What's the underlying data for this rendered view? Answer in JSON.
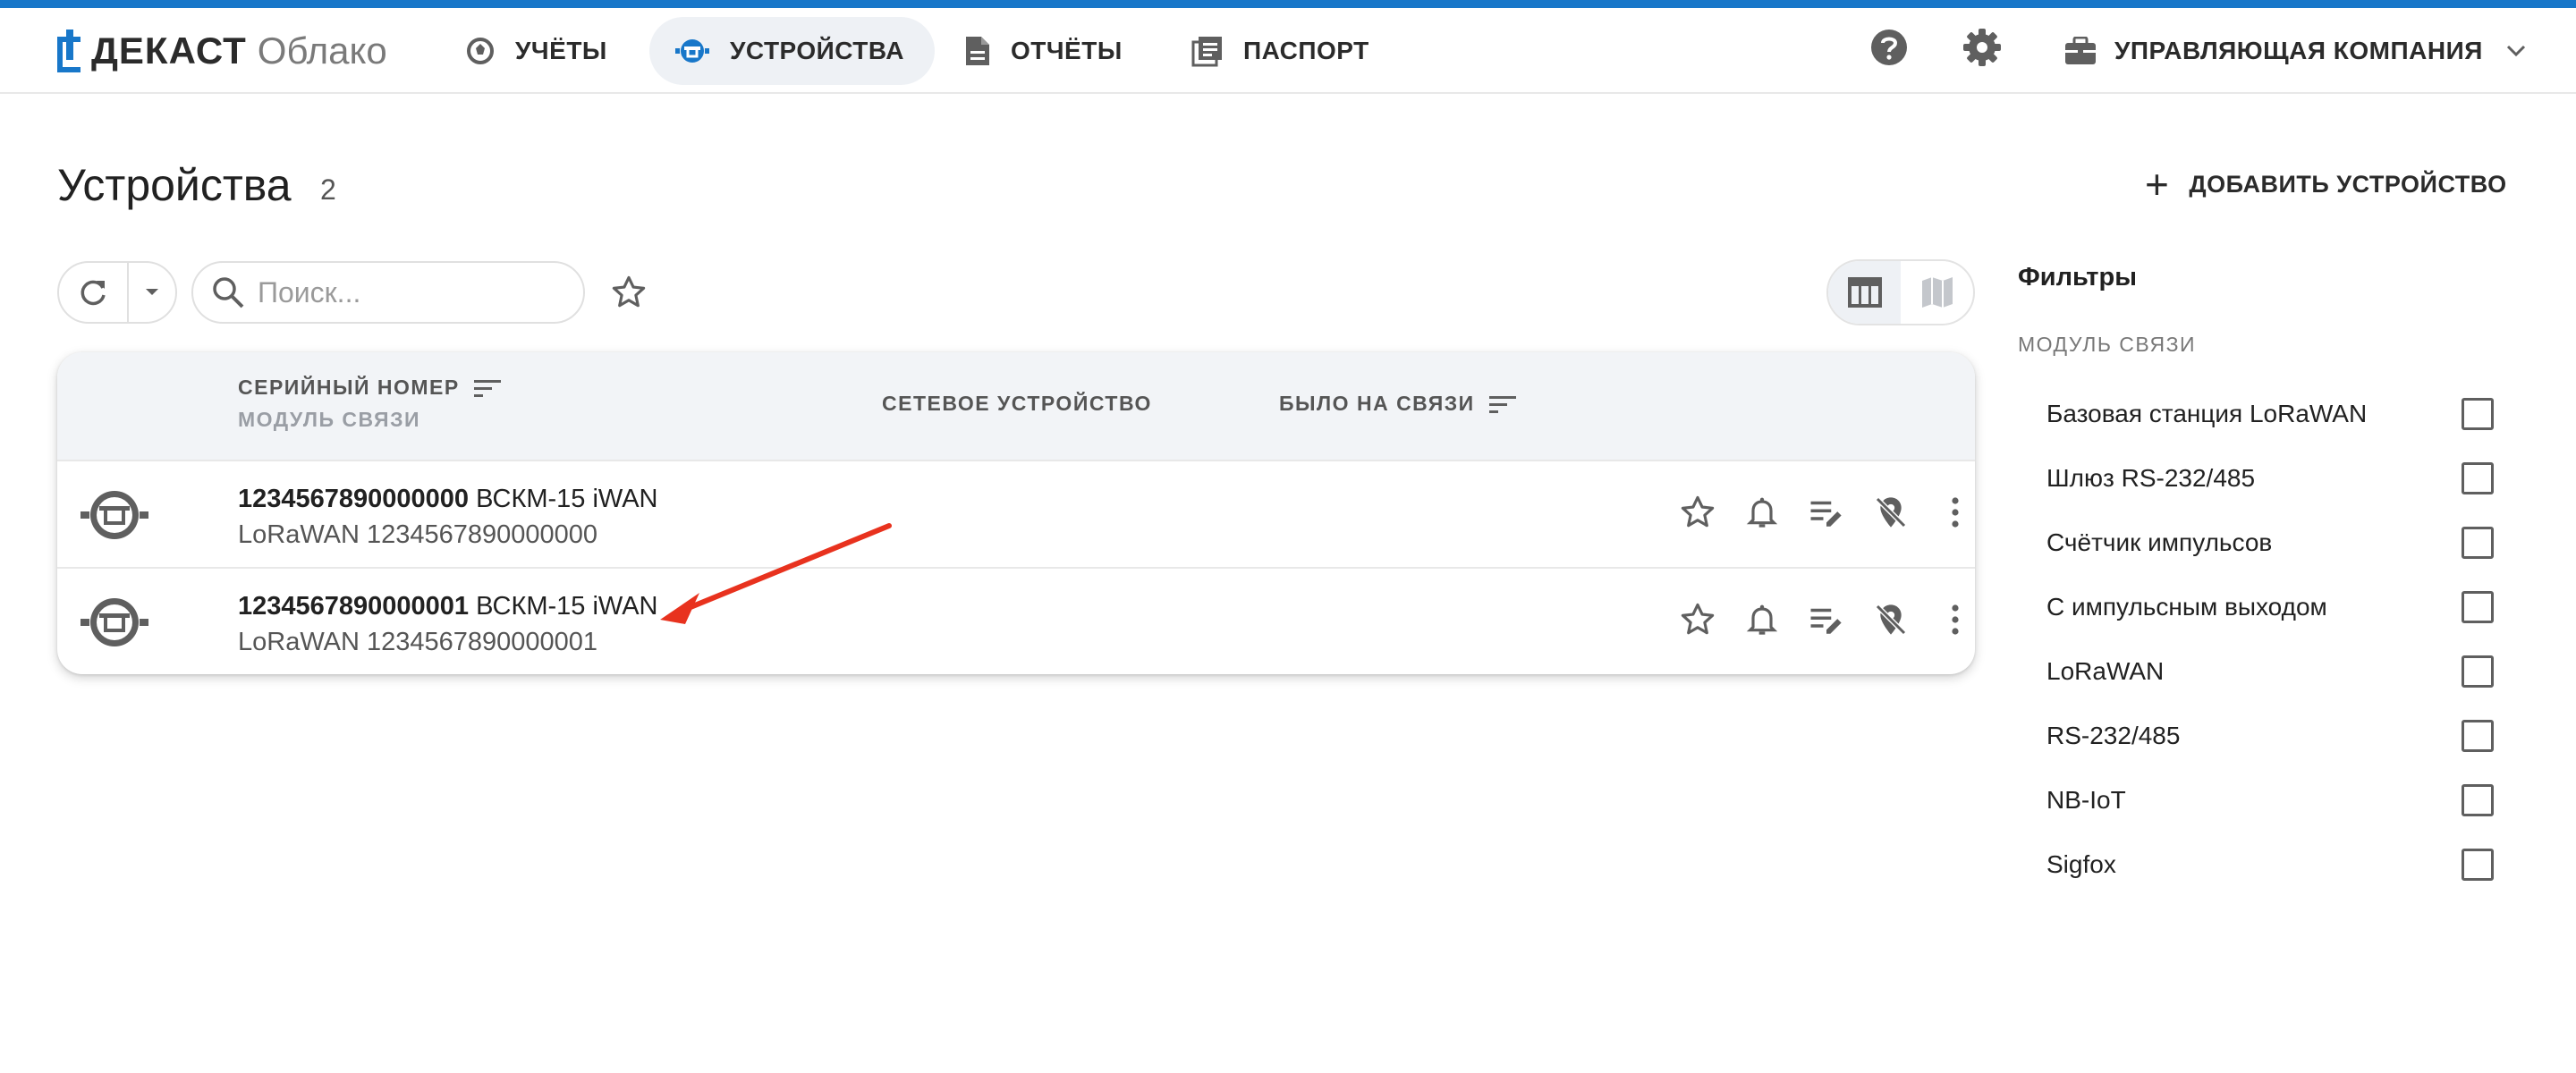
{
  "header": {
    "brand": "ДЕКАСТ",
    "brand_sub": "Облако",
    "nav": [
      {
        "label": "УЧЁТЫ",
        "icon": "meter-dial-icon"
      },
      {
        "label": "УСТРОЙСТВА",
        "icon": "device-icon",
        "active": true
      },
      {
        "label": "ОТЧЁТЫ",
        "icon": "document-icon"
      },
      {
        "label": "ПАСПОРТ",
        "icon": "passport-icon"
      }
    ],
    "help_icon": "help-icon",
    "settings_icon": "gear-icon",
    "company": "УПРАВЛЯЮЩАЯ КОМПАНИЯ"
  },
  "page": {
    "title": "Устройства",
    "count": "2",
    "add_label": "ДОБАВИТЬ УСТРОЙСТВО"
  },
  "toolbar": {
    "search_placeholder": "Поиск..."
  },
  "table": {
    "col_serial": "СЕРИЙНЫЙ НОМЕР",
    "col_module": "МОДУЛЬ СВЯЗИ",
    "col_network": "СЕТЕВОЕ УСТРОЙСТВО",
    "col_last_seen": "БЫЛО НА СВЯЗИ",
    "rows": [
      {
        "serial": "1234567890000000",
        "model": "ВСКМ-15 iWAN",
        "module": "LoRaWAN 1234567890000000"
      },
      {
        "serial": "1234567890000001",
        "model": "ВСКМ-15 iWAN",
        "module": "LoRaWAN 1234567890000001"
      }
    ]
  },
  "filters": {
    "title": "Фильтры",
    "section": "МОДУЛЬ СВЯЗИ",
    "items": [
      {
        "label": "Базовая станция LoRaWAN",
        "checked": false
      },
      {
        "label": "Шлюз RS-232/485",
        "checked": false
      },
      {
        "label": "Счётчик импульсов",
        "checked": false
      },
      {
        "label": "С импульсным выходом",
        "checked": false
      },
      {
        "label": "LoRaWAN",
        "checked": false
      },
      {
        "label": "RS-232/485",
        "checked": false
      },
      {
        "label": "NB-IoT",
        "checked": false
      },
      {
        "label": "Sigfox",
        "checked": false
      }
    ]
  },
  "colors": {
    "accent": "#1877c9",
    "arrow": "#e8321e"
  }
}
